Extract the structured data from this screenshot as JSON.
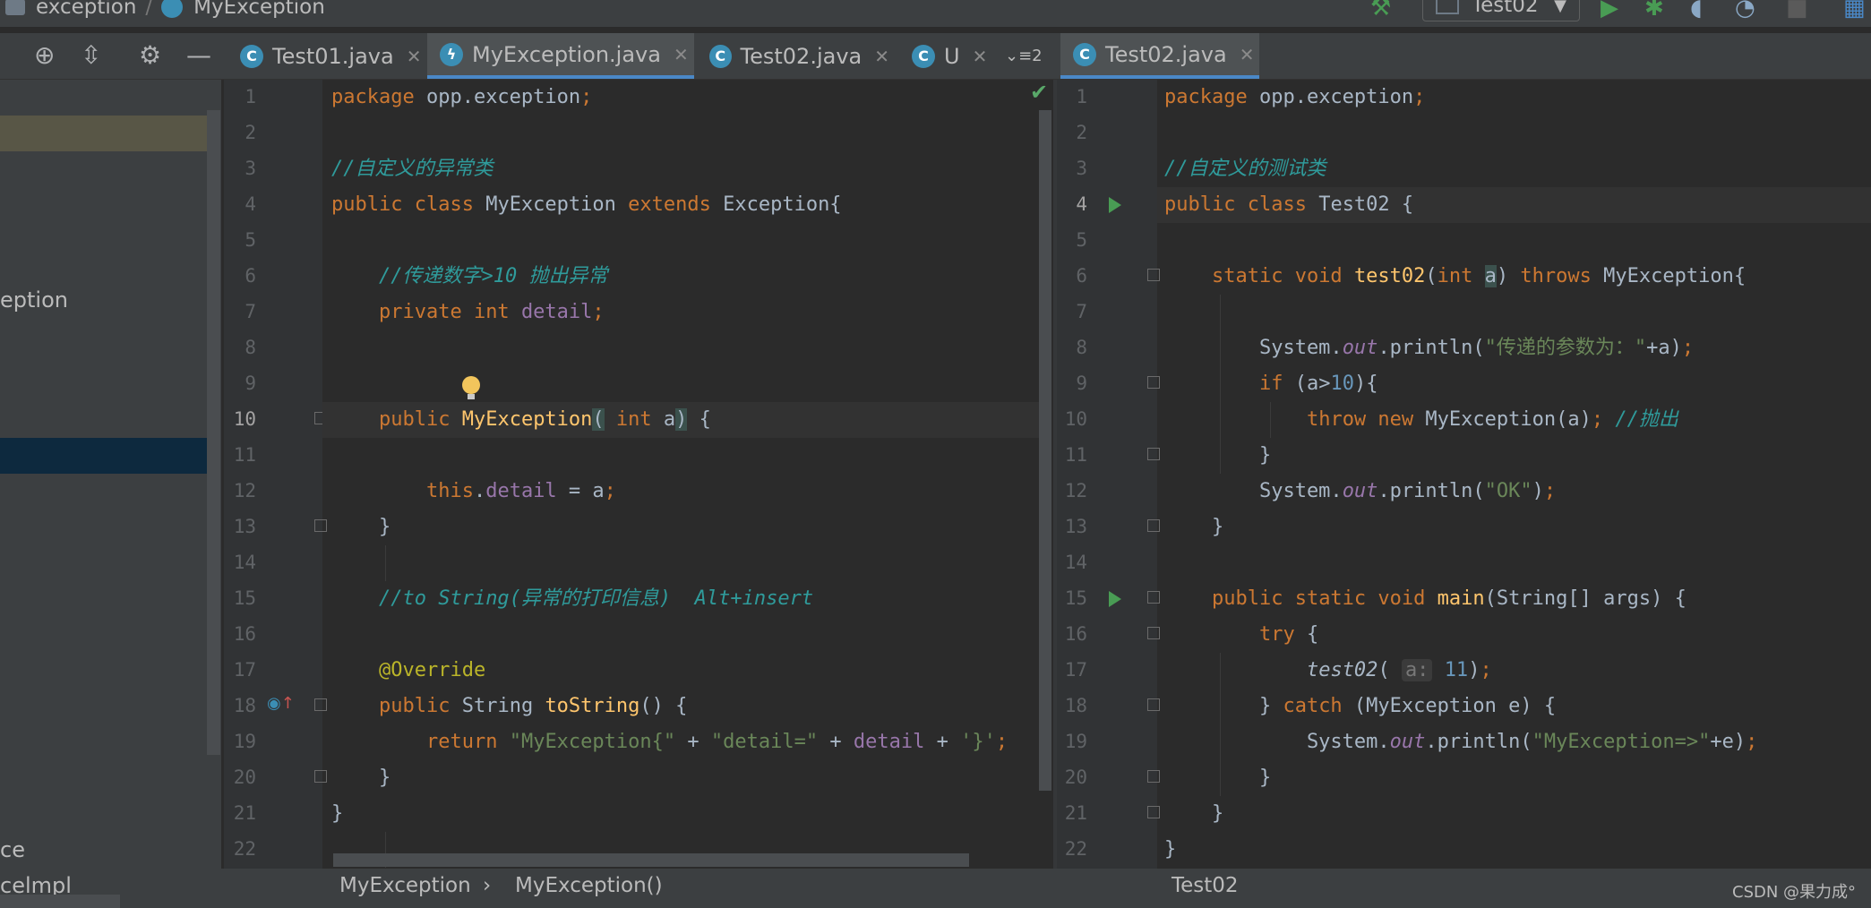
{
  "navbar": {
    "crumb1": "exception",
    "crumb_sep": "/",
    "crumb2": "MyException",
    "run_config": "Test02"
  },
  "toolbar": {
    "locate_icon": "⊕",
    "collapse_icon": "⇳",
    "settings_icon": "⚙",
    "hide_icon": "—",
    "tab_overflow": "⌄≡2"
  },
  "tabs_left": [
    {
      "label": "Test01.java",
      "close": "✕",
      "icon_letter": "C"
    },
    {
      "label": "MyException.java",
      "close": "✕",
      "icon_letter": "ϟ"
    },
    {
      "label": "Test02.java",
      "close": "✕",
      "icon_letter": "C"
    },
    {
      "label": "U",
      "close": "✕",
      "icon_letter": "C"
    }
  ],
  "tabs_right": [
    {
      "label": "Test02.java",
      "close": "✕",
      "icon_letter": "C"
    }
  ],
  "project_pane": {
    "item1": "eption",
    "item2": "ce",
    "item3": "celmpl"
  },
  "left_editor": {
    "line_numbers": [
      "1",
      "2",
      "3",
      "4",
      "5",
      "6",
      "7",
      "8",
      "9",
      "10",
      "11",
      "12",
      "13",
      "14",
      "15",
      "16",
      "17",
      "18",
      "19",
      "20",
      "21",
      "22"
    ],
    "status_check": "✔"
  },
  "right_editor": {
    "line_numbers": [
      "1",
      "2",
      "3",
      "4",
      "5",
      "6",
      "7",
      "8",
      "9",
      "10",
      "11",
      "12",
      "13",
      "14",
      "15",
      "16",
      "17",
      "18",
      "19",
      "20",
      "21",
      "22"
    ]
  },
  "bottom": {
    "left_crumb1": "MyException",
    "left_sep": "›",
    "left_crumb2": "MyException()",
    "right_crumb": "Test02",
    "watermark": "CSDN @果力成°"
  },
  "colors": {
    "keyword": "#cc7832",
    "comment": "#629755",
    "string": "#6a8759",
    "number": "#6897bb",
    "function": "#ffc66d",
    "field": "#9876aa"
  }
}
